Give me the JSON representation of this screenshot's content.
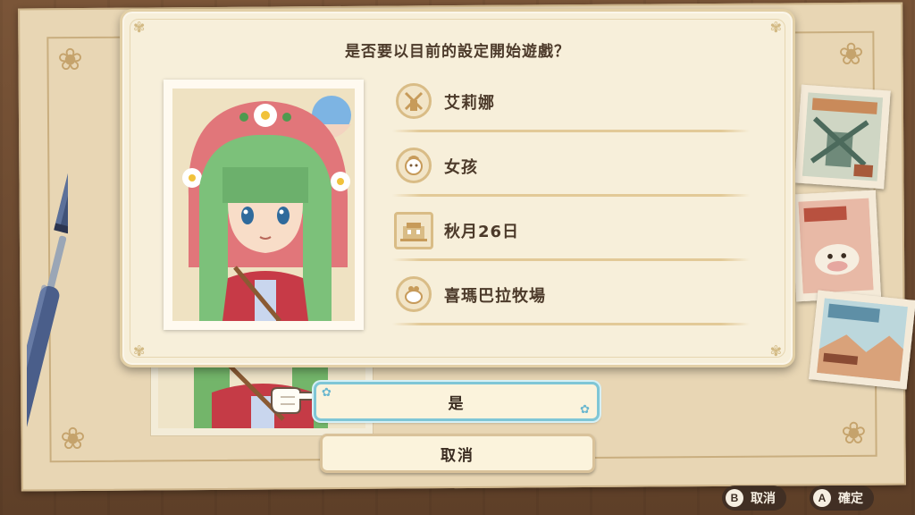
{
  "dialog": {
    "title": "是否要以目前的設定開始遊戲？",
    "rows": [
      {
        "icon": "windmill-icon",
        "value": "艾莉娜"
      },
      {
        "icon": "face-icon",
        "value": "女孩"
      },
      {
        "icon": "calendar-building-icon",
        "value": "秋月26日"
      },
      {
        "icon": "farm-bag-icon",
        "value": "喜瑪巴拉牧場"
      }
    ]
  },
  "choices": {
    "yes": "是",
    "cancel": "取消"
  },
  "controls": {
    "b_button": "B",
    "b_label": "取消",
    "a_button": "A",
    "a_label": "確定"
  },
  "colors": {
    "dialog_bg": "#f7efda",
    "text": "#4c3a2a",
    "selected_border": "#7fc6d6",
    "icon_ring": "#d9bc86"
  }
}
